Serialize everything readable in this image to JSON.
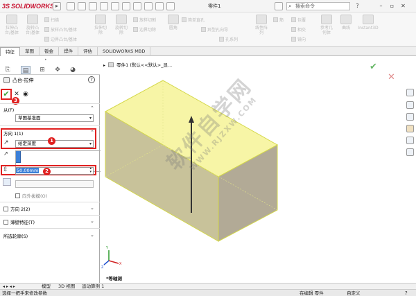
{
  "titlebar": {
    "logo_ds": "3S",
    "logo_text": "SOLIDWORKS",
    "doc_title": "零件1",
    "search_placeholder": "搜索命令",
    "caret": "▸"
  },
  "ribbon": {
    "large_buttons": [
      {
        "label": "拉伸凸\n台/基体"
      },
      {
        "label": "旋转凸\n台/基体"
      },
      {
        "label": "拉伸切\n除"
      },
      {
        "label": "旋转切\n除"
      },
      {
        "label": "圆角"
      },
      {
        "label": "线性阵\n列"
      },
      {
        "label": "筋"
      },
      {
        "label": "参考几\n何体"
      },
      {
        "label": "曲线"
      },
      {
        "label": "Instant3D"
      }
    ],
    "small_buttons": [
      {
        "label": "扫描"
      },
      {
        "label": "放样凸台/基体"
      },
      {
        "label": "边界凸台/基体"
      },
      {
        "label": "放样切割"
      },
      {
        "label": "边界切除"
      },
      {
        "label": "简单直孔"
      },
      {
        "label": "异型孔向导"
      },
      {
        "label": "孔系列"
      },
      {
        "label": "包覆"
      },
      {
        "label": "相交"
      },
      {
        "label": "镜向"
      }
    ]
  },
  "tabs": [
    {
      "label": "特征"
    },
    {
      "label": "草图"
    },
    {
      "label": "钣金"
    },
    {
      "label": "焊件"
    },
    {
      "label": "评估"
    },
    {
      "label": "SOLIDWORKS MBD"
    }
  ],
  "property_manager": {
    "title": "凸台-拉伸",
    "help": "?",
    "from_label": "从(F)",
    "from_value": "草图基准面",
    "direction1_label": "方向 1(1)",
    "end_condition": "给定深度",
    "depth_value": "50.00mm",
    "draft_outward": "向外拔模(O)",
    "direction2_label": "方向 2(2)",
    "thin_feature_label": "薄壁特征(T)",
    "selected_contours_label": "所选轮廓(S)"
  },
  "annotations": {
    "badge1": "1",
    "badge2": "2",
    "badge3": "3"
  },
  "graphics": {
    "breadcrumb": "零件1 (默认<<默认>_显...",
    "view_label": "*等轴测",
    "watermark": "软件自学网",
    "watermark_url": "WWW.RJZXW.COM",
    "model_color": "#f7f5a6",
    "model_edge_color": "#d4d84a"
  },
  "bottom_tabs": [
    {
      "label": "模型"
    },
    {
      "label": "3D 视图"
    },
    {
      "label": "运动算例 1"
    }
  ],
  "status": {
    "hint": "选择一把手来修改参数",
    "edit_mode": "在编辑 零件",
    "custom": "自定义"
  }
}
